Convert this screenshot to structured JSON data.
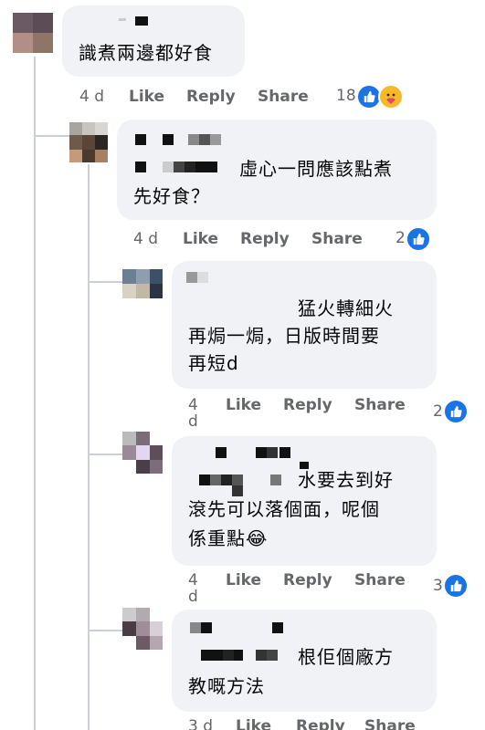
{
  "comments": [
    {
      "text": "識煮兩邊都好食",
      "time": "4 d",
      "like": "Like",
      "reply": "Reply",
      "share": "Share",
      "reaction_count": "18",
      "reactions": [
        "like-icon",
        "care-icon"
      ]
    },
    {
      "text_line1": "虛心一問應該點煮",
      "text_line2": "先好食？",
      "time": "4 d",
      "like": "Like",
      "reply": "Reply",
      "share": "Share",
      "reaction_count": "2",
      "reactions": [
        "like-icon"
      ]
    },
    {
      "text_line1": "猛火轉細火",
      "text_line2": "再焗一焗，日版時間要",
      "text_line3": "再短d",
      "time_top": "4",
      "time_bottom": "d",
      "like": "Like",
      "reply": "Reply",
      "share": "Share",
      "reaction_count": "2",
      "reactions": [
        "like-icon"
      ]
    },
    {
      "text_line1": "水要去到好",
      "text_line2": "滾先可以落個面，呢個",
      "text_line3": "係重點😂",
      "time_top": "4",
      "time_bottom": "d",
      "like": "Like",
      "reply": "Reply",
      "share": "Share",
      "reaction_count": "3",
      "reactions": [
        "like-icon"
      ]
    },
    {
      "text_line1": "根佢個廠方",
      "text_line2": "教嘅方法",
      "time": "3 d",
      "like": "Like",
      "reply": "Reply",
      "share": "Share"
    }
  ],
  "colors": {
    "bubble": "#f0f2f5",
    "meta": "#65676b",
    "like_blue": "#1b74e4",
    "care_yellow": "#f7b928"
  }
}
